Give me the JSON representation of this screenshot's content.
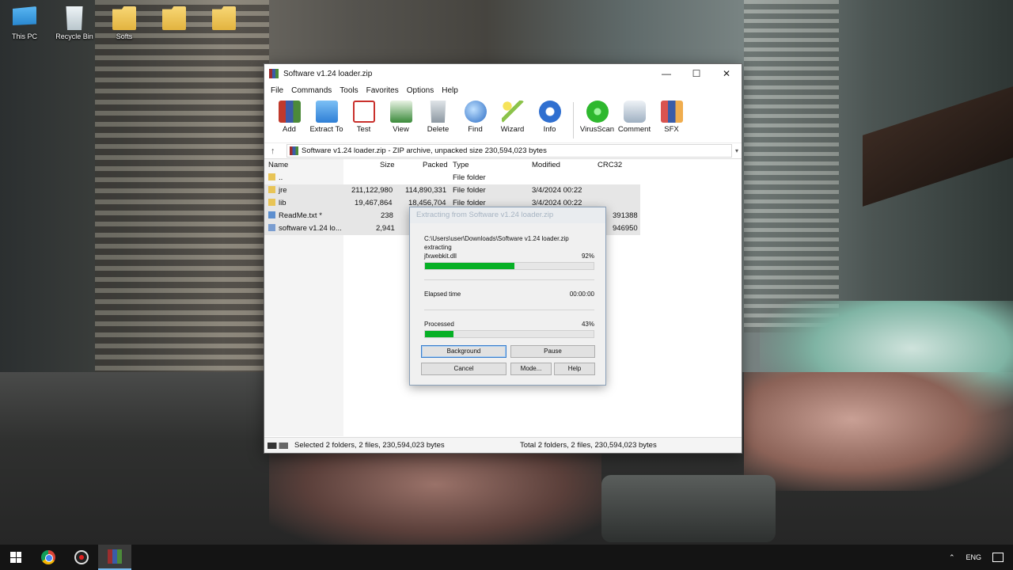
{
  "desktop": {
    "icons": [
      {
        "label": "This PC",
        "icon": "this-pc-icon"
      },
      {
        "label": "Recycle Bin",
        "icon": "recycle-bin-icon"
      },
      {
        "label": "Softs",
        "icon": "folder-icon"
      },
      {
        "label": "",
        "icon": "folder-icon"
      },
      {
        "label": "",
        "icon": "folder-icon"
      }
    ]
  },
  "window": {
    "title": "Software v1.24 loader.zip",
    "controls": {
      "minimize": "—",
      "maximize": "☐",
      "close": "✕"
    },
    "menu": [
      "File",
      "Commands",
      "Tools",
      "Favorites",
      "Options",
      "Help"
    ],
    "toolbar": [
      {
        "label": "Add",
        "icon": "add-icon",
        "color": "#c0392b"
      },
      {
        "label": "Extract To",
        "icon": "extract-to-icon",
        "color": "#3b8fe0"
      },
      {
        "label": "Test",
        "icon": "test-icon",
        "color": "#c9302c"
      },
      {
        "label": "View",
        "icon": "view-icon",
        "color": "#3a8a3a"
      },
      {
        "label": "Delete",
        "icon": "delete-icon",
        "color": "#9aa4ad"
      },
      {
        "label": "Find",
        "icon": "find-icon",
        "color": "#2a6cc4"
      },
      {
        "label": "Wizard",
        "icon": "wizard-icon",
        "color": "#8bc34a"
      },
      {
        "label": "Info",
        "icon": "info-icon",
        "color": "#2f6fd0"
      },
      {
        "label": "VirusScan",
        "icon": "virusscan-icon",
        "color": "#2eb82e"
      },
      {
        "label": "Comment",
        "icon": "comment-icon",
        "color": "#7d8ea0"
      },
      {
        "label": "SFX",
        "icon": "sfx-icon",
        "color": "#d9534f"
      }
    ],
    "address": "Software v1.24 loader.zip - ZIP archive, unpacked size 230,594,023 bytes",
    "columns": [
      "Name",
      "Size",
      "Packed",
      "Type",
      "Modified",
      "CRC32"
    ],
    "files": [
      {
        "name": "..",
        "size": "",
        "packed": "",
        "type": "File folder",
        "modified": "",
        "crc": "",
        "kind": "folder",
        "selected": false
      },
      {
        "name": "jre",
        "size": "211,122,980",
        "packed": "114,890,331",
        "type": "File folder",
        "modified": "3/4/2024 00:22",
        "crc": "",
        "kind": "folder",
        "selected": true
      },
      {
        "name": "lib",
        "size": "19,467,864",
        "packed": "18,456,704",
        "type": "File folder",
        "modified": "3/4/2024 00:22",
        "crc": "",
        "kind": "folder",
        "selected": true
      },
      {
        "name": "ReadMe.txt *",
        "size": "238",
        "packed": "",
        "type": "",
        "modified": "",
        "crc": "391388",
        "kind": "doc",
        "selected": true
      },
      {
        "name": "software v1.24 lo...",
        "size": "2,941",
        "packed": "",
        "type": "",
        "modified": "",
        "crc": "946950",
        "kind": "zip",
        "selected": true
      }
    ],
    "status_left": "Selected 2 folders, 2 files, 230,594,023 bytes",
    "status_right": "Total 2 folders, 2 files, 230,594,023 bytes"
  },
  "dialog": {
    "title": "Extracting from Software v1.24 loader.zip",
    "path": "C:\\Users\\user\\Downloads\\Software v1.24 loader.zip",
    "action": "extracting",
    "current_file": "jfxwebkit.dll",
    "file_percent_label": "92%",
    "file_progress": 0.53,
    "elapsed_label": "Elapsed time",
    "elapsed_value": "00:00:00",
    "processed_label": "Processed",
    "processed_percent_label": "43%",
    "processed_progress": 0.17,
    "buttons": {
      "background": "Background",
      "pause": "Pause",
      "cancel": "Cancel",
      "mode": "Mode...",
      "help": "Help"
    }
  },
  "taskbar": {
    "tray_lang": "ENG",
    "tray_up": "⌃"
  },
  "colors": {
    "progress": "#06b025",
    "selection": "#e6e6e6",
    "accent": "#3a7ecb"
  }
}
